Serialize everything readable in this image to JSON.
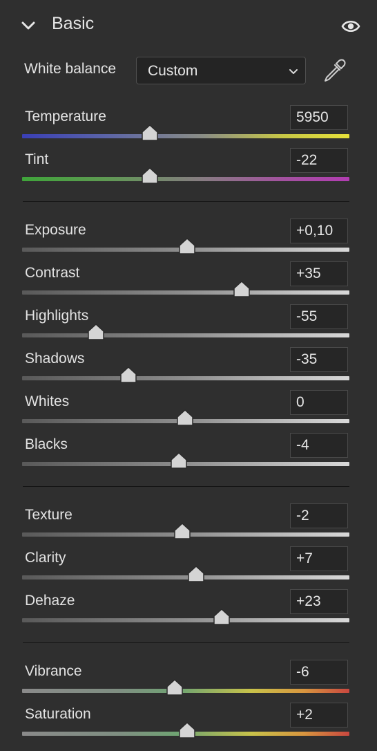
{
  "panel": {
    "title": "Basic",
    "white_balance": {
      "label": "White balance",
      "selected": "Custom"
    }
  },
  "sliders": [
    {
      "label": "Temperature",
      "value": "5950",
      "position": 0.39,
      "gradient": "temp"
    },
    {
      "label": "Tint",
      "value": "-22",
      "position": 0.39,
      "gradient": "tint"
    },
    {
      "label": "Exposure",
      "value": "+0,10",
      "position": 0.505,
      "gradient": "gray"
    },
    {
      "label": "Contrast",
      "value": "+35",
      "position": 0.67,
      "gradient": "gray"
    },
    {
      "label": "Highlights",
      "value": "-55",
      "position": 0.225,
      "gradient": "gray"
    },
    {
      "label": "Shadows",
      "value": "-35",
      "position": 0.325,
      "gradient": "gray"
    },
    {
      "label": "Whites",
      "value": "0",
      "position": 0.497,
      "gradient": "gray"
    },
    {
      "label": "Blacks",
      "value": "-4",
      "position": 0.478,
      "gradient": "gray"
    },
    {
      "label": "Texture",
      "value": "-2",
      "position": 0.49,
      "gradient": "gray"
    },
    {
      "label": "Clarity",
      "value": "+7",
      "position": 0.532,
      "gradient": "gray"
    },
    {
      "label": "Dehaze",
      "value": "+23",
      "position": 0.61,
      "gradient": "gray"
    },
    {
      "label": "Vibrance",
      "value": "-6",
      "position": 0.467,
      "gradient": "color"
    },
    {
      "label": "Saturation",
      "value": "+2",
      "position": 0.505,
      "gradient": "color"
    }
  ],
  "icons": {
    "collapse": "chevron-down-icon",
    "visibility": "eye-icon",
    "dropdown": "chevron-down-icon",
    "eyedropper": "eyedropper-icon"
  },
  "colors": {
    "background": "#2f2f2f",
    "field": "#262626",
    "text": "#e3e3e3",
    "thumb": "#d4d4d4",
    "divider": "#151515"
  }
}
